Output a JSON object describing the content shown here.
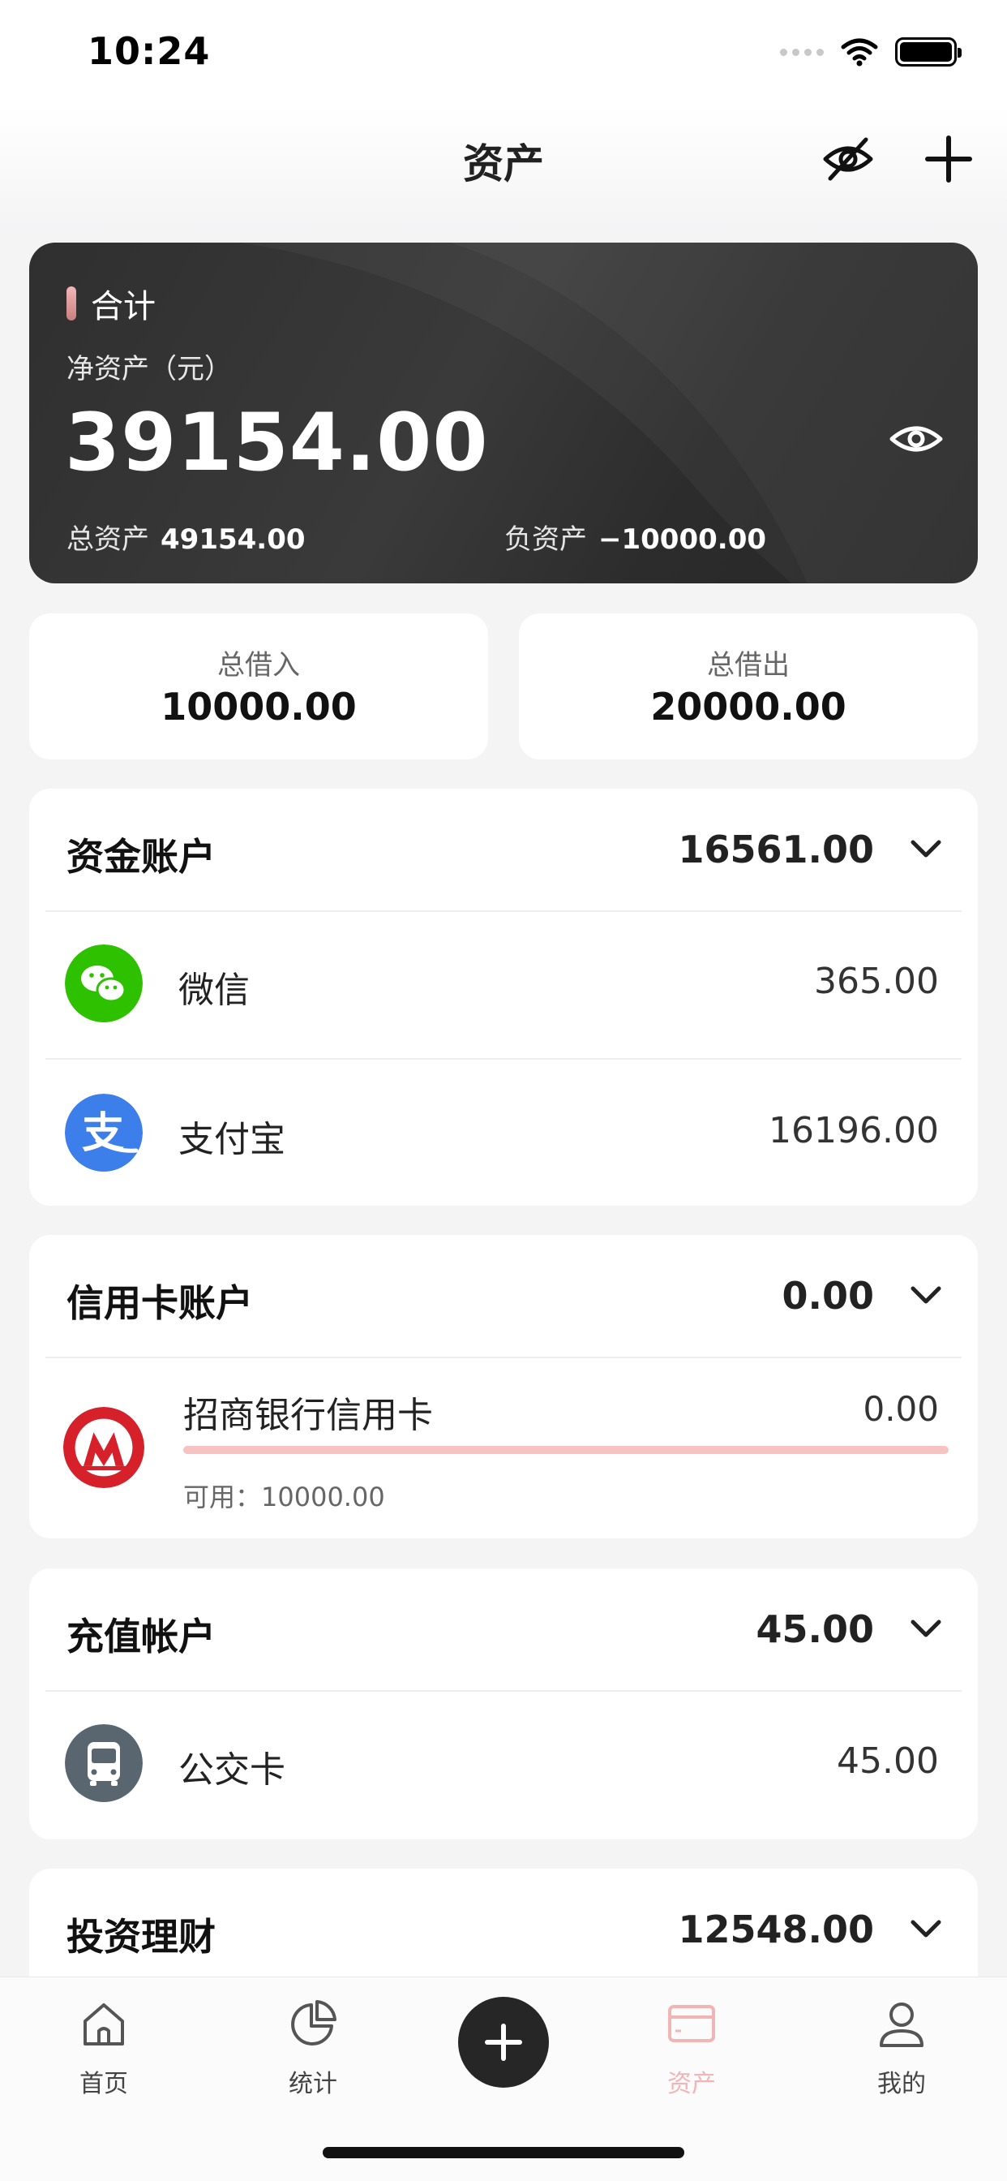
{
  "status_bar": {
    "time": "10:24"
  },
  "header": {
    "title": "资产"
  },
  "summary": {
    "label": "合计",
    "net_caption": "净资产（元）",
    "net_value": "39154.00",
    "total_assets_label": "总资产",
    "total_assets_value": "49154.00",
    "liabilities_label": "负资产",
    "liabilities_value": "−10000.00"
  },
  "loans": {
    "borrowed_in_label": "总借入",
    "borrowed_in_value": "10000.00",
    "lent_out_label": "总借出",
    "lent_out_value": "20000.00"
  },
  "sections": [
    {
      "title": "资金账户",
      "total": "16561.00",
      "items": [
        {
          "name": "微信",
          "amount": "365.00",
          "icon": "wechat-icon"
        },
        {
          "name": "支付宝",
          "amount": "16196.00",
          "icon": "alipay-icon"
        }
      ]
    },
    {
      "title": "信用卡账户",
      "total": "0.00",
      "items": [
        {
          "name": "招商银行信用卡",
          "amount": "0.00",
          "available": "可用：10000.00",
          "icon": "cmb-bank-icon",
          "usage": 0
        }
      ]
    },
    {
      "title": "充值帐户",
      "total": "45.00",
      "items": [
        {
          "name": "公交卡",
          "amount": "45.00",
          "icon": "bus-icon"
        }
      ]
    },
    {
      "title": "投资理财",
      "total": "12548.00",
      "items": []
    }
  ],
  "tabs": [
    {
      "label": "首页",
      "icon": "home-icon"
    },
    {
      "label": "统计",
      "icon": "pie-chart-icon"
    },
    {
      "label": "资产",
      "icon": "card-icon",
      "active": true
    },
    {
      "label": "我的",
      "icon": "user-icon"
    }
  ],
  "colors": {
    "wechat": "#2DC100",
    "alipay": "#3C7EEA",
    "cmb": "#D6202A",
    "bus": "#59666F",
    "active_tab": "#F2B5B5",
    "card_dark": "#2F2F2F"
  }
}
